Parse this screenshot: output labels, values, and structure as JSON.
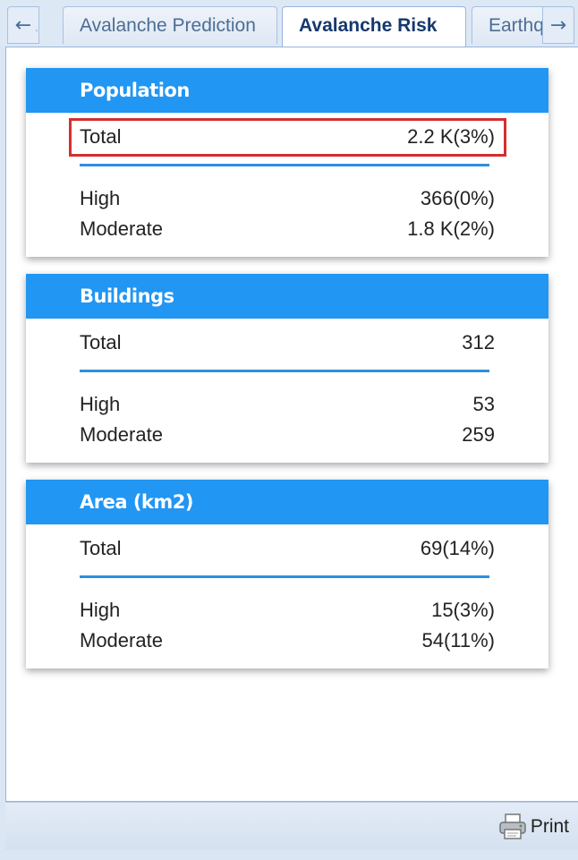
{
  "tabs": {
    "prev_arrow": "←",
    "next_arrow": "→",
    "items": [
      {
        "label": "Avalanche Prediction"
      },
      {
        "label": "Avalanche Risk"
      },
      {
        "label": "Earthq"
      }
    ]
  },
  "cards": {
    "population": {
      "title": "Population",
      "total_label": "Total",
      "total_value": "2.2 K(3%)",
      "high_label": "High",
      "high_value": "366(0%)",
      "moderate_label": "Moderate",
      "moderate_value": "1.8 K(2%)"
    },
    "buildings": {
      "title": "Buildings",
      "total_label": "Total",
      "total_value": "312",
      "high_label": "High",
      "high_value": "53",
      "moderate_label": "Moderate",
      "moderate_value": "259"
    },
    "area": {
      "title": "Area (km2)",
      "total_label": "Total",
      "total_value": "69(14%)",
      "high_label": "High",
      "high_value": "15(3%)",
      "moderate_label": "Moderate",
      "moderate_value": "54(11%)"
    }
  },
  "footer": {
    "print_label": "Print",
    "print_icon": "printer-icon"
  },
  "colors": {
    "header_blue": "#2196f3",
    "highlight_red": "#d32f2f",
    "active_tab_text": "#15386e"
  }
}
